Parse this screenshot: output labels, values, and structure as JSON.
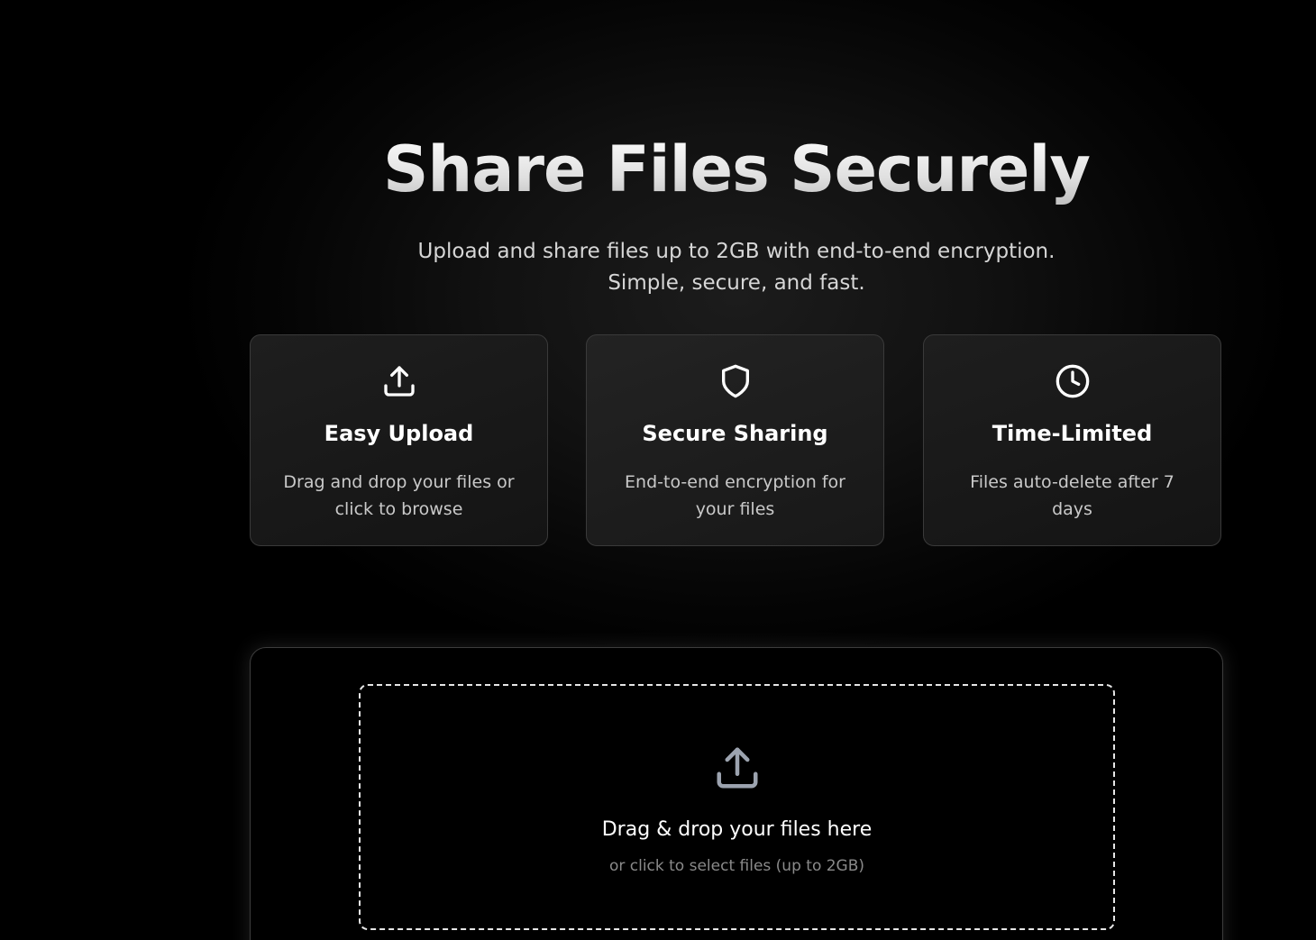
{
  "hero": {
    "title": "Share Files Securely",
    "subtitle": "Upload and share files up to 2GB with end-to-end encryption. Simple, secure, and fast."
  },
  "features": [
    {
      "icon": "upload-icon",
      "title": "Easy Upload",
      "description": "Drag and drop your files or click to browse"
    },
    {
      "icon": "shield-icon",
      "title": "Secure Sharing",
      "description": "End-to-end encryption for your files"
    },
    {
      "icon": "clock-icon",
      "title": "Time-Limited",
      "description": "Files auto-delete after 7 days"
    }
  ],
  "dropzone": {
    "icon": "upload-icon",
    "title": "Drag & drop your files here",
    "subtitle": "or click to select files (up to 2GB)"
  },
  "colors": {
    "background": "#000000",
    "card_border": "#3a3a3a",
    "muted_text": "#8a8a8a"
  }
}
